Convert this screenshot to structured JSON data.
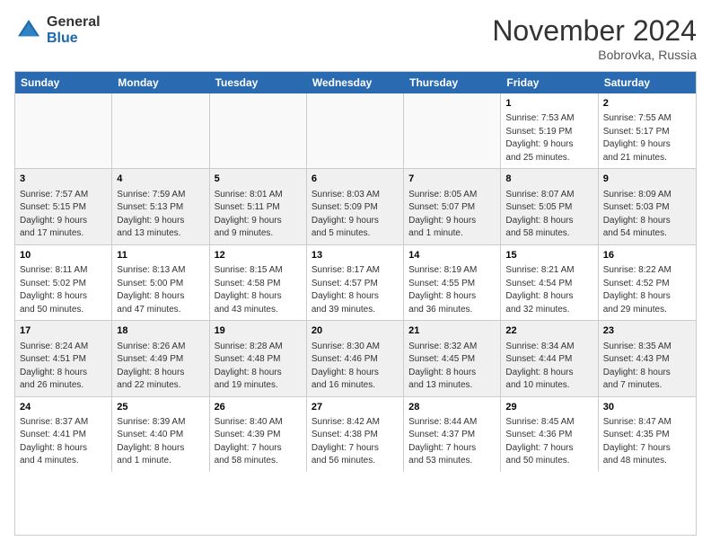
{
  "logo": {
    "general": "General",
    "blue": "Blue"
  },
  "title": "November 2024",
  "location": "Bobrovka, Russia",
  "header_days": [
    "Sunday",
    "Monday",
    "Tuesday",
    "Wednesday",
    "Thursday",
    "Friday",
    "Saturday"
  ],
  "weeks": [
    [
      {
        "day": "",
        "info": ""
      },
      {
        "day": "",
        "info": ""
      },
      {
        "day": "",
        "info": ""
      },
      {
        "day": "",
        "info": ""
      },
      {
        "day": "",
        "info": ""
      },
      {
        "day": "1",
        "info": "Sunrise: 7:53 AM\nSunset: 5:19 PM\nDaylight: 9 hours\nand 25 minutes."
      },
      {
        "day": "2",
        "info": "Sunrise: 7:55 AM\nSunset: 5:17 PM\nDaylight: 9 hours\nand 21 minutes."
      }
    ],
    [
      {
        "day": "3",
        "info": "Sunrise: 7:57 AM\nSunset: 5:15 PM\nDaylight: 9 hours\nand 17 minutes."
      },
      {
        "day": "4",
        "info": "Sunrise: 7:59 AM\nSunset: 5:13 PM\nDaylight: 9 hours\nand 13 minutes."
      },
      {
        "day": "5",
        "info": "Sunrise: 8:01 AM\nSunset: 5:11 PM\nDaylight: 9 hours\nand 9 minutes."
      },
      {
        "day": "6",
        "info": "Sunrise: 8:03 AM\nSunset: 5:09 PM\nDaylight: 9 hours\nand 5 minutes."
      },
      {
        "day": "7",
        "info": "Sunrise: 8:05 AM\nSunset: 5:07 PM\nDaylight: 9 hours\nand 1 minute."
      },
      {
        "day": "8",
        "info": "Sunrise: 8:07 AM\nSunset: 5:05 PM\nDaylight: 8 hours\nand 58 minutes."
      },
      {
        "day": "9",
        "info": "Sunrise: 8:09 AM\nSunset: 5:03 PM\nDaylight: 8 hours\nand 54 minutes."
      }
    ],
    [
      {
        "day": "10",
        "info": "Sunrise: 8:11 AM\nSunset: 5:02 PM\nDaylight: 8 hours\nand 50 minutes."
      },
      {
        "day": "11",
        "info": "Sunrise: 8:13 AM\nSunset: 5:00 PM\nDaylight: 8 hours\nand 47 minutes."
      },
      {
        "day": "12",
        "info": "Sunrise: 8:15 AM\nSunset: 4:58 PM\nDaylight: 8 hours\nand 43 minutes."
      },
      {
        "day": "13",
        "info": "Sunrise: 8:17 AM\nSunset: 4:57 PM\nDaylight: 8 hours\nand 39 minutes."
      },
      {
        "day": "14",
        "info": "Sunrise: 8:19 AM\nSunset: 4:55 PM\nDaylight: 8 hours\nand 36 minutes."
      },
      {
        "day": "15",
        "info": "Sunrise: 8:21 AM\nSunset: 4:54 PM\nDaylight: 8 hours\nand 32 minutes."
      },
      {
        "day": "16",
        "info": "Sunrise: 8:22 AM\nSunset: 4:52 PM\nDaylight: 8 hours\nand 29 minutes."
      }
    ],
    [
      {
        "day": "17",
        "info": "Sunrise: 8:24 AM\nSunset: 4:51 PM\nDaylight: 8 hours\nand 26 minutes."
      },
      {
        "day": "18",
        "info": "Sunrise: 8:26 AM\nSunset: 4:49 PM\nDaylight: 8 hours\nand 22 minutes."
      },
      {
        "day": "19",
        "info": "Sunrise: 8:28 AM\nSunset: 4:48 PM\nDaylight: 8 hours\nand 19 minutes."
      },
      {
        "day": "20",
        "info": "Sunrise: 8:30 AM\nSunset: 4:46 PM\nDaylight: 8 hours\nand 16 minutes."
      },
      {
        "day": "21",
        "info": "Sunrise: 8:32 AM\nSunset: 4:45 PM\nDaylight: 8 hours\nand 13 minutes."
      },
      {
        "day": "22",
        "info": "Sunrise: 8:34 AM\nSunset: 4:44 PM\nDaylight: 8 hours\nand 10 minutes."
      },
      {
        "day": "23",
        "info": "Sunrise: 8:35 AM\nSunset: 4:43 PM\nDaylight: 8 hours\nand 7 minutes."
      }
    ],
    [
      {
        "day": "24",
        "info": "Sunrise: 8:37 AM\nSunset: 4:41 PM\nDaylight: 8 hours\nand 4 minutes."
      },
      {
        "day": "25",
        "info": "Sunrise: 8:39 AM\nSunset: 4:40 PM\nDaylight: 8 hours\nand 1 minute."
      },
      {
        "day": "26",
        "info": "Sunrise: 8:40 AM\nSunset: 4:39 PM\nDaylight: 7 hours\nand 58 minutes."
      },
      {
        "day": "27",
        "info": "Sunrise: 8:42 AM\nSunset: 4:38 PM\nDaylight: 7 hours\nand 56 minutes."
      },
      {
        "day": "28",
        "info": "Sunrise: 8:44 AM\nSunset: 4:37 PM\nDaylight: 7 hours\nand 53 minutes."
      },
      {
        "day": "29",
        "info": "Sunrise: 8:45 AM\nSunset: 4:36 PM\nDaylight: 7 hours\nand 50 minutes."
      },
      {
        "day": "30",
        "info": "Sunrise: 8:47 AM\nSunset: 4:35 PM\nDaylight: 7 hours\nand 48 minutes."
      }
    ]
  ]
}
